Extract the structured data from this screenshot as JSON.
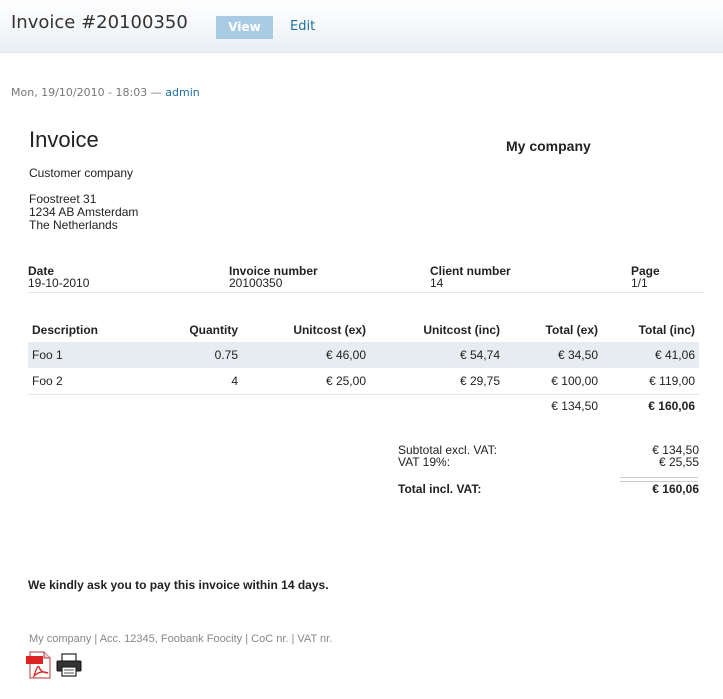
{
  "page": {
    "title": "Invoice #20100350",
    "tabs": {
      "view": "View",
      "edit": "Edit"
    },
    "submitted_date": "Mon, 19/10/2010 - 18:03 —",
    "submitted_author": "admin"
  },
  "invoice": {
    "heading": "Invoice",
    "company": "My company",
    "customer": "Customer company",
    "address": [
      "Foostreet 31",
      "1234 AB Amsterdam",
      "The Netherlands"
    ],
    "meta": {
      "date_label": "Date",
      "date": "19-10-2010",
      "invoice_number_label": "Invoice number",
      "invoice_number": "20100350",
      "client_number_label": "Client number",
      "client_number": "14",
      "page_label": "Page",
      "page": "1/1"
    },
    "columns": [
      "Description",
      "Quantity",
      "Unitcost (ex)",
      "Unitcost (inc)",
      "Total (ex)",
      "Total (inc)"
    ],
    "rows": [
      [
        "Foo 1",
        "0.75",
        "€ 46,00",
        "€ 54,74",
        "€ 34,50",
        "€ 41,06"
      ],
      [
        "Foo 2",
        "4",
        "€ 25,00",
        "€ 29,75",
        "€ 100,00",
        "€ 119,00"
      ]
    ],
    "sum_ex": "€ 134,50",
    "sum_inc": "€ 160,06",
    "subtotal_label": "Subtotal excl. VAT:",
    "subtotal_value": "€ 134,50",
    "vat_label": "VAT 19%:",
    "vat_value": "€ 25,55",
    "total_label": "Total incl. VAT:",
    "total_value": "€ 160,06",
    "payment_note": "We kindly ask you to pay this invoice within 14 days.",
    "footer": "My company | Acc. 12345, Foobank Foocity | CoC nr. | VAT nr."
  },
  "icons": {
    "pdf": "pdf-icon",
    "print": "printer-icon"
  },
  "colors": {
    "link": "#1e6f9e",
    "tab_active": "#a9cbe3",
    "row_stripe": "#e6ecf0"
  }
}
